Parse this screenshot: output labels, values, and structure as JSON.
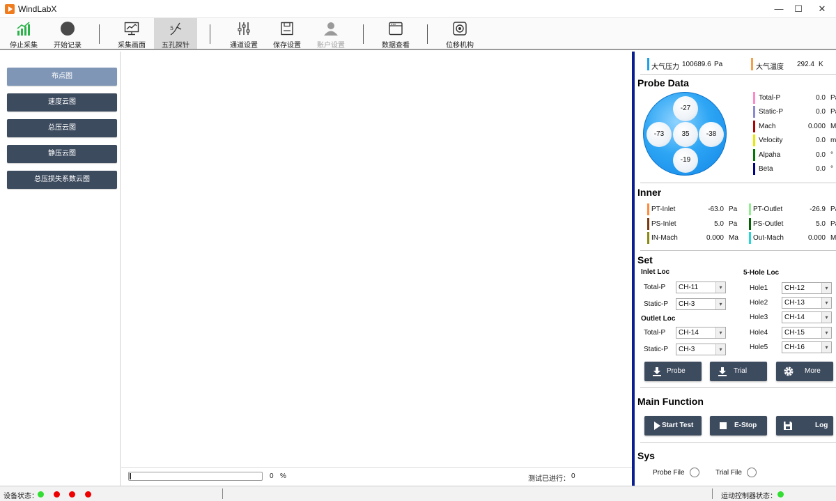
{
  "window": {
    "title": "WindLabX",
    "minimize": "—",
    "maximize": "☐",
    "close": "✕"
  },
  "toolbar": {
    "items": [
      {
        "label": "停止采集",
        "icon": "bar-chart-up-icon"
      },
      {
        "label": "开始记录",
        "icon": "record-dot-icon"
      },
      {
        "label": "采集画面",
        "icon": "monitor-chart-icon"
      },
      {
        "label": "五孔探针",
        "icon": "probe-icon",
        "active": true
      },
      {
        "label": "通道设置",
        "icon": "sliders-icon"
      },
      {
        "label": "保存设置",
        "icon": "save-icon"
      },
      {
        "label": "账户设置",
        "icon": "user-icon",
        "disabled": true
      },
      {
        "label": "数据查看",
        "icon": "window-icon"
      },
      {
        "label": "位移机构",
        "icon": "camera-icon"
      }
    ]
  },
  "leftnav": {
    "items": [
      {
        "label": "布点图",
        "active": true
      },
      {
        "label": "速度云图"
      },
      {
        "label": "总压云图"
      },
      {
        "label": "静压云图"
      },
      {
        "label": "总压损失系数云图"
      }
    ]
  },
  "progress": {
    "value": 0,
    "percent_text": "0",
    "percent_unit": "%",
    "run_label": "测试已进行：",
    "run_value": "0"
  },
  "atmosphere": {
    "pressure_label": "大气压力",
    "pressure_value": "100689.6",
    "pressure_unit": "Pa",
    "temp_label": "大气温度",
    "temp_value": "292.4",
    "temp_unit": "K"
  },
  "probe_data": {
    "title": "Probe Data",
    "holes": {
      "top": "-27",
      "left": "-73",
      "center": "35",
      "right": "-38",
      "bottom": "-19"
    },
    "rows": [
      {
        "label": "Total-P",
        "value": "0.0",
        "unit": "Pa",
        "color": "#ff88cc"
      },
      {
        "label": "Static-P",
        "value": "0.0",
        "unit": "Pa",
        "color": "#8a8ad0"
      },
      {
        "label": "Mach",
        "value": "0.000",
        "unit": "Ma",
        "color": "#b00000"
      },
      {
        "label": "Velocity",
        "value": "0.0",
        "unit": "m/s",
        "color": "#e8e800"
      },
      {
        "label": "Alpaha",
        "value": "0.0",
        "unit": "°",
        "color": "#007a00"
      },
      {
        "label": "Beta",
        "value": "0.0",
        "unit": "°",
        "color": "#00008a"
      }
    ]
  },
  "inner": {
    "title": "Inner",
    "left": [
      {
        "label": "PT-Inlet",
        "value": "-63.0",
        "unit": "Pa",
        "color": "#ff8a3c"
      },
      {
        "label": "PS-Inlet",
        "value": "5.0",
        "unit": "Pa",
        "color": "#7a3a10"
      },
      {
        "label": "IN-Mach",
        "value": "0.000",
        "unit": "Ma",
        "color": "#8a8a10"
      }
    ],
    "right": [
      {
        "label": "PT-Outlet",
        "value": "-26.9",
        "unit": "Pa",
        "color": "#90ee90"
      },
      {
        "label": "PS-Outlet",
        "value": "5.0",
        "unit": "Pa",
        "color": "#006400"
      },
      {
        "label": "Out-Mach",
        "value": "0.000",
        "unit": "Ma",
        "color": "#20d8d8"
      }
    ]
  },
  "set": {
    "title": "Set",
    "inlet_title": "Inlet Loc",
    "outlet_title": "Outlet Loc",
    "hole_title": "5-Hole Loc",
    "inlet": [
      {
        "label": "Total-P",
        "value": "CH-11"
      },
      {
        "label": "Static-P",
        "value": "CH-3"
      }
    ],
    "outlet": [
      {
        "label": "Total-P",
        "value": "CH-14"
      },
      {
        "label": "Static-P",
        "value": "CH-3"
      }
    ],
    "holes": [
      {
        "label": "Hole1",
        "value": "CH-12"
      },
      {
        "label": "Hole2",
        "value": "CH-13"
      },
      {
        "label": "Hole3",
        "value": "CH-14"
      },
      {
        "label": "Hole4",
        "value": "CH-15"
      },
      {
        "label": "Hole5",
        "value": "CH-16"
      }
    ],
    "buttons": {
      "probe": "Probe",
      "trial": "Trial",
      "more": "More"
    }
  },
  "main_function": {
    "title": "Main Function",
    "start": "Start Test",
    "estop": "E-Stop",
    "log": "Log"
  },
  "sys": {
    "title": "Sys",
    "probe_file": "Probe File",
    "trial_file": "Trial File"
  },
  "statusbar": {
    "device_label": "设备状态：",
    "device_dots": [
      "#33dd33",
      "#ee0000",
      "#ee0000",
      "#ee0000"
    ],
    "motion_label": "运动控制器状态：",
    "motion_dot": "#33dd33"
  }
}
